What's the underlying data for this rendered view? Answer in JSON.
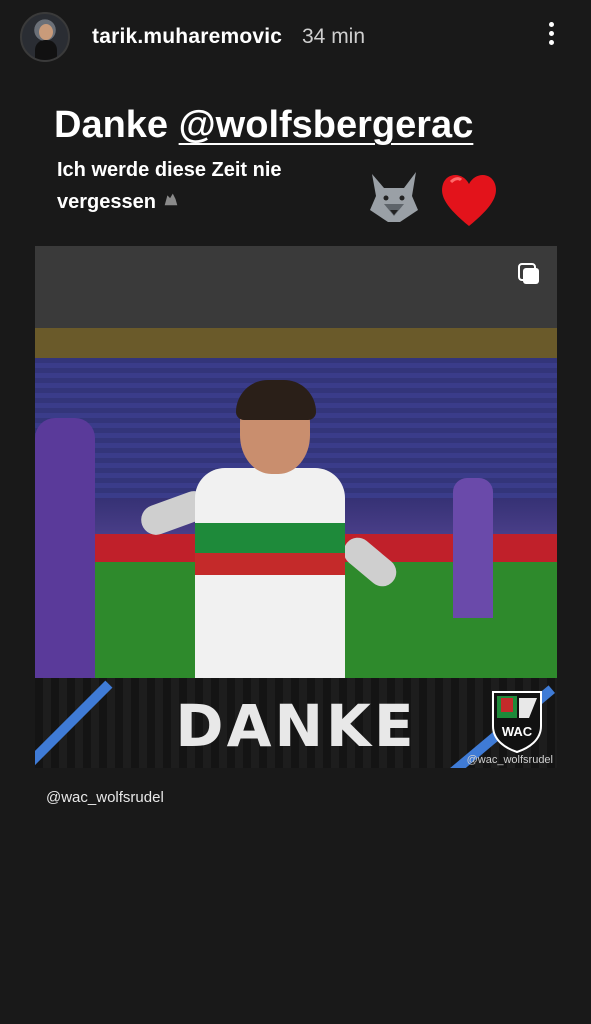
{
  "header": {
    "username": "tarik.muharemovic",
    "time": "34 min",
    "more_icon": "vertical-ellipsis-icon",
    "avatar_icon": "profile-avatar"
  },
  "story": {
    "title_prefix": "Danke",
    "title_mention": "@wolfsbergerac",
    "subtitle": "Ich werde diese Zeit nie vergessen",
    "emojis": [
      "wolf-icon",
      "heart-icon"
    ]
  },
  "post": {
    "carousel_icon": "carousel-icon",
    "banner_text": "DANKE",
    "logo_text": "WAC",
    "credit": "@wac_wolfsrudel",
    "accent_color": "#3f7bd6"
  },
  "caption": "@wac_wolfsrudel"
}
